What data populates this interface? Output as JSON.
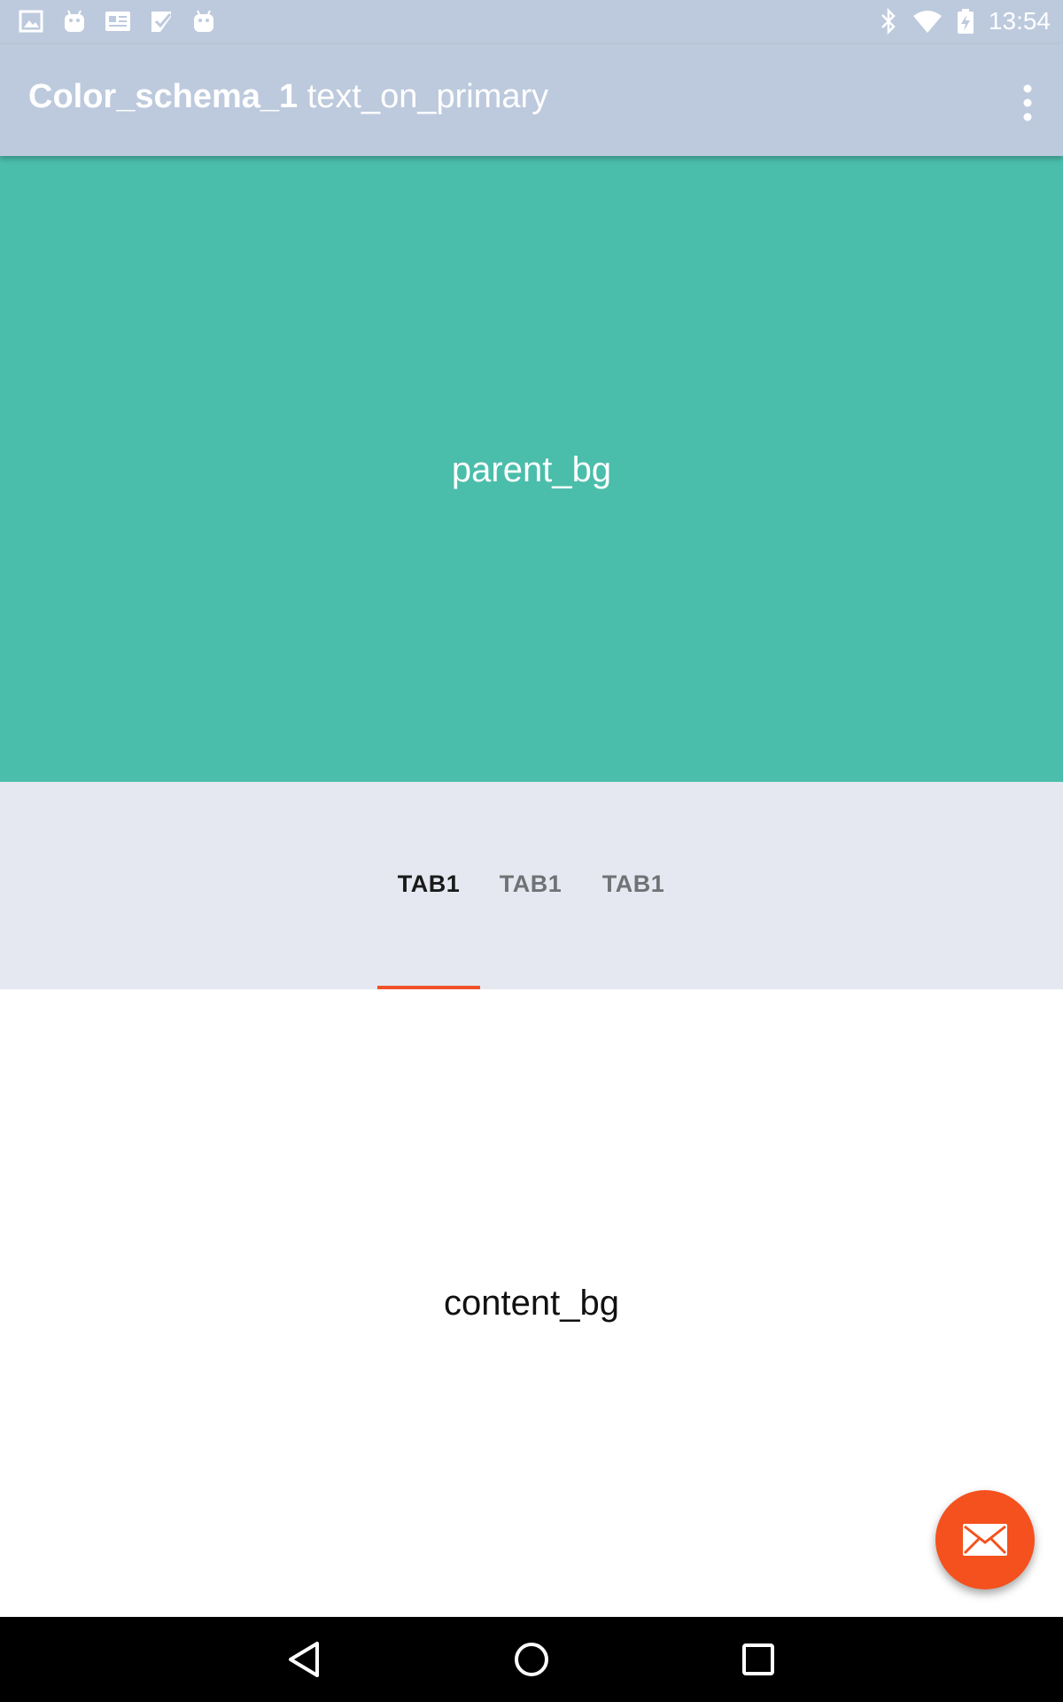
{
  "statusbar": {
    "time": "13:54",
    "left_icons": [
      "image-icon",
      "android-icon",
      "news-icon",
      "check-badge-icon",
      "android-icon"
    ],
    "right_icons": [
      "bluetooth-icon",
      "wifi-icon",
      "battery-charging-icon"
    ]
  },
  "appbar": {
    "title_bold": "Color_schema_1",
    "title_rest": "text_on_primary",
    "overflow_icon": "more-vert-icon"
  },
  "hero": {
    "label": "parent_bg",
    "color": "#4bbdab"
  },
  "tabs": {
    "items": [
      {
        "label": "TAB1",
        "active": true
      },
      {
        "label": "TAB1",
        "active": false
      },
      {
        "label": "TAB1",
        "active": false
      }
    ],
    "indicator_color": "#f0522a",
    "background": "#e5e8f0"
  },
  "content": {
    "label": "content_bg"
  },
  "fab": {
    "icon": "mail-icon",
    "color": "#f4511e"
  },
  "navbar": {
    "buttons": [
      "back-icon",
      "home-icon",
      "recents-icon"
    ]
  },
  "colors": {
    "primary": "#bdcadd",
    "accent": "#f4511e"
  }
}
